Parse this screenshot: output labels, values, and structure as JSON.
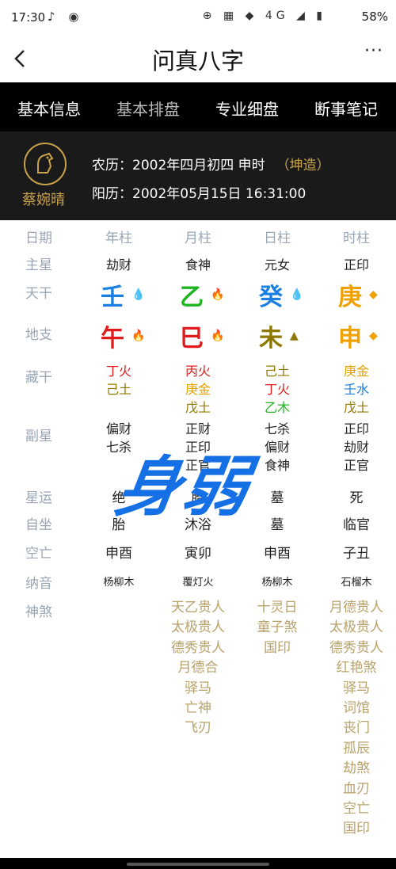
{
  "status": {
    "time": "17:30",
    "battery": "58%",
    "left_icons": "♪ ◉",
    "right_icons": "⊕ ▦ ◆ 4G ◢ ▮"
  },
  "nav": {
    "back": "‹",
    "title": "问真八字",
    "more": "···"
  },
  "tabs": [
    "基本信息",
    "基本排盘",
    "专业细盘",
    "断事笔记"
  ],
  "active_tab_index": 1,
  "profile": {
    "name": "蔡婉晴",
    "lunar": "农历：2002年四月初四 申时",
    "gender": "（坤造）",
    "solar": "阳历：2002年05月15日 16:31:00"
  },
  "row_labels": {
    "date": "日期",
    "main_star": "主星",
    "tiangan": "天干",
    "dizhi": "地支",
    "canggan": "藏干",
    "fuxing": "副星",
    "xingyun": "星运",
    "zizuo": "自坐",
    "kongwang": "空亡",
    "nayin": "纳音",
    "shensha": "神煞"
  },
  "columns": [
    "年柱",
    "月柱",
    "日柱",
    "时柱"
  ],
  "main_star": [
    "劫财",
    "食神",
    "元女",
    "正印"
  ],
  "tiangan": [
    {
      "char": "壬",
      "color": "#1a7fe0",
      "icon": "💧"
    },
    {
      "char": "乙",
      "color": "#1fb520",
      "icon": "🔥"
    },
    {
      "char": "癸",
      "color": "#1a7fe0",
      "icon": "💧"
    },
    {
      "char": "庚",
      "color": "#f0a000",
      "icon": "◆"
    }
  ],
  "dizhi": [
    {
      "char": "午",
      "color": "#e01b1b",
      "icon": "🔥"
    },
    {
      "char": "巳",
      "color": "#e01b1b",
      "icon": "🔥"
    },
    {
      "char": "未",
      "color": "#8f7800",
      "icon": "▲"
    },
    {
      "char": "申",
      "color": "#f0a000",
      "icon": "◆"
    }
  ],
  "canggan": [
    [
      {
        "t": "丁火",
        "c": "#e01b1b"
      },
      {
        "t": "己土",
        "c": "#8f7800"
      }
    ],
    [
      {
        "t": "丙火",
        "c": "#e01b1b"
      },
      {
        "t": "庚金",
        "c": "#e0a000"
      },
      {
        "t": "戊土",
        "c": "#8f7800"
      }
    ],
    [
      {
        "t": "己土",
        "c": "#8f7800"
      },
      {
        "t": "丁火",
        "c": "#e01b1b"
      },
      {
        "t": "乙木",
        "c": "#1fb520"
      }
    ],
    [
      {
        "t": "庚金",
        "c": "#e0a000"
      },
      {
        "t": "壬水",
        "c": "#1a7fe0"
      },
      {
        "t": "戊土",
        "c": "#8f7800"
      }
    ]
  ],
  "fuxing": [
    [
      "偏财",
      "七杀"
    ],
    [
      "正财",
      "正印",
      "正官"
    ],
    [
      "七杀",
      "偏财",
      "食神"
    ],
    [
      "正印",
      "劫财",
      "正官"
    ]
  ],
  "xingyun": [
    "绝",
    "胎",
    "墓",
    "死"
  ],
  "zizuo": [
    "胎",
    "沐浴",
    "墓",
    "临官"
  ],
  "kongwang": [
    "申酉",
    "寅卯",
    "申酉",
    "子丑"
  ],
  "nayin": [
    "杨柳木",
    "覆灯火",
    "杨柳木",
    "石榴木"
  ],
  "shensha": [
    [],
    [
      "天乙贵人",
      "太极贵人",
      "德秀贵人",
      "月德合",
      "驿马",
      "亡神",
      "飞刃"
    ],
    [
      "十灵日",
      "童子煞",
      "国印"
    ],
    [
      "月德贵人",
      "太极贵人",
      "德秀贵人",
      "红艳煞",
      "驿马",
      "词馆",
      "丧门",
      "孤辰",
      "劫煞",
      "血刃",
      "空亡",
      "国印"
    ]
  ],
  "watermark": "身弱"
}
